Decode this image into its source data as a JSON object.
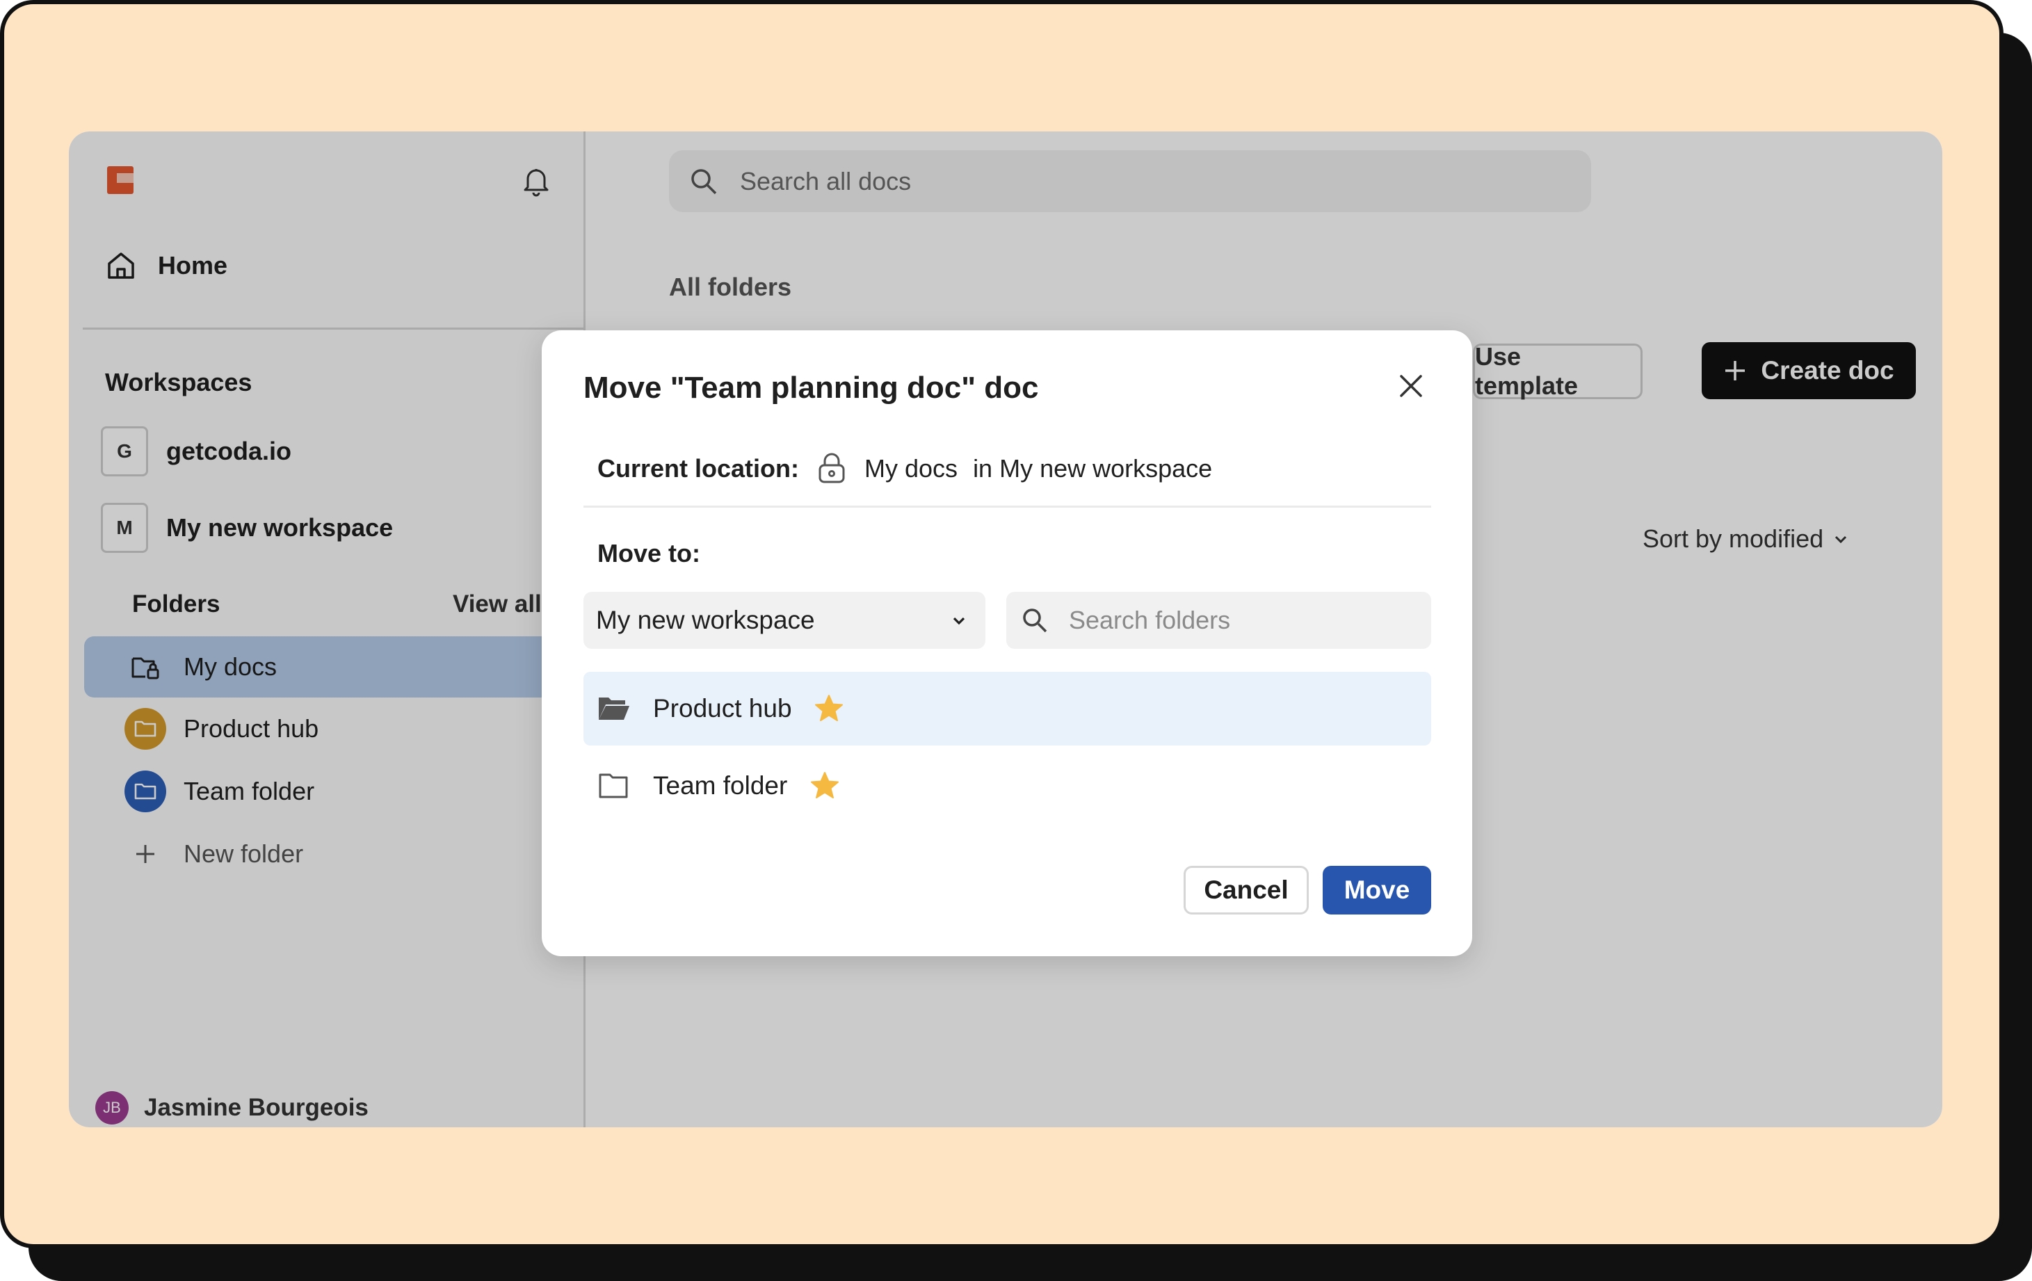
{
  "sidebar": {
    "home_label": "Home",
    "workspaces_title": "Workspaces",
    "workspaces": [
      {
        "initial": "G",
        "name": "getcoda.io"
      },
      {
        "initial": "M",
        "name": "My new workspace"
      }
    ],
    "folders_title": "Folders",
    "view_all_label": "View all",
    "folders": [
      {
        "name": "My docs",
        "icon": "lock-folder-icon"
      },
      {
        "name": "Product hub",
        "icon": "folder-icon",
        "color": "#d49a2a"
      },
      {
        "name": "Team folder",
        "icon": "folder-icon",
        "color": "#2d5fb8"
      }
    ],
    "new_folder_label": "New folder",
    "user": {
      "initials": "JB",
      "name": "Jasmine Bourgeois"
    }
  },
  "main": {
    "search_placeholder": "Search all docs",
    "all_folders_label": "All folders",
    "use_template_label": "Use template",
    "create_doc_label": "Create doc",
    "sort_label": "Sort by modified",
    "help_label": "?"
  },
  "modal": {
    "title": "Move \"Team planning doc\" doc",
    "current_location_label": "Current location:",
    "current_folder": "My docs",
    "current_workspace": "in My new workspace",
    "move_to_label": "Move to:",
    "workspace_select_value": "My new workspace",
    "folder_search_placeholder": "Search folders",
    "targets": [
      {
        "name": "Product hub",
        "selected": true,
        "starred": true
      },
      {
        "name": "Team folder",
        "selected": false,
        "starred": true
      }
    ],
    "cancel_label": "Cancel",
    "move_label": "Move"
  },
  "colors": {
    "frame_bg": "#ffe4c4",
    "accent_blue": "#2856ae",
    "star": "#f5b941",
    "logo": "#e4572e"
  }
}
